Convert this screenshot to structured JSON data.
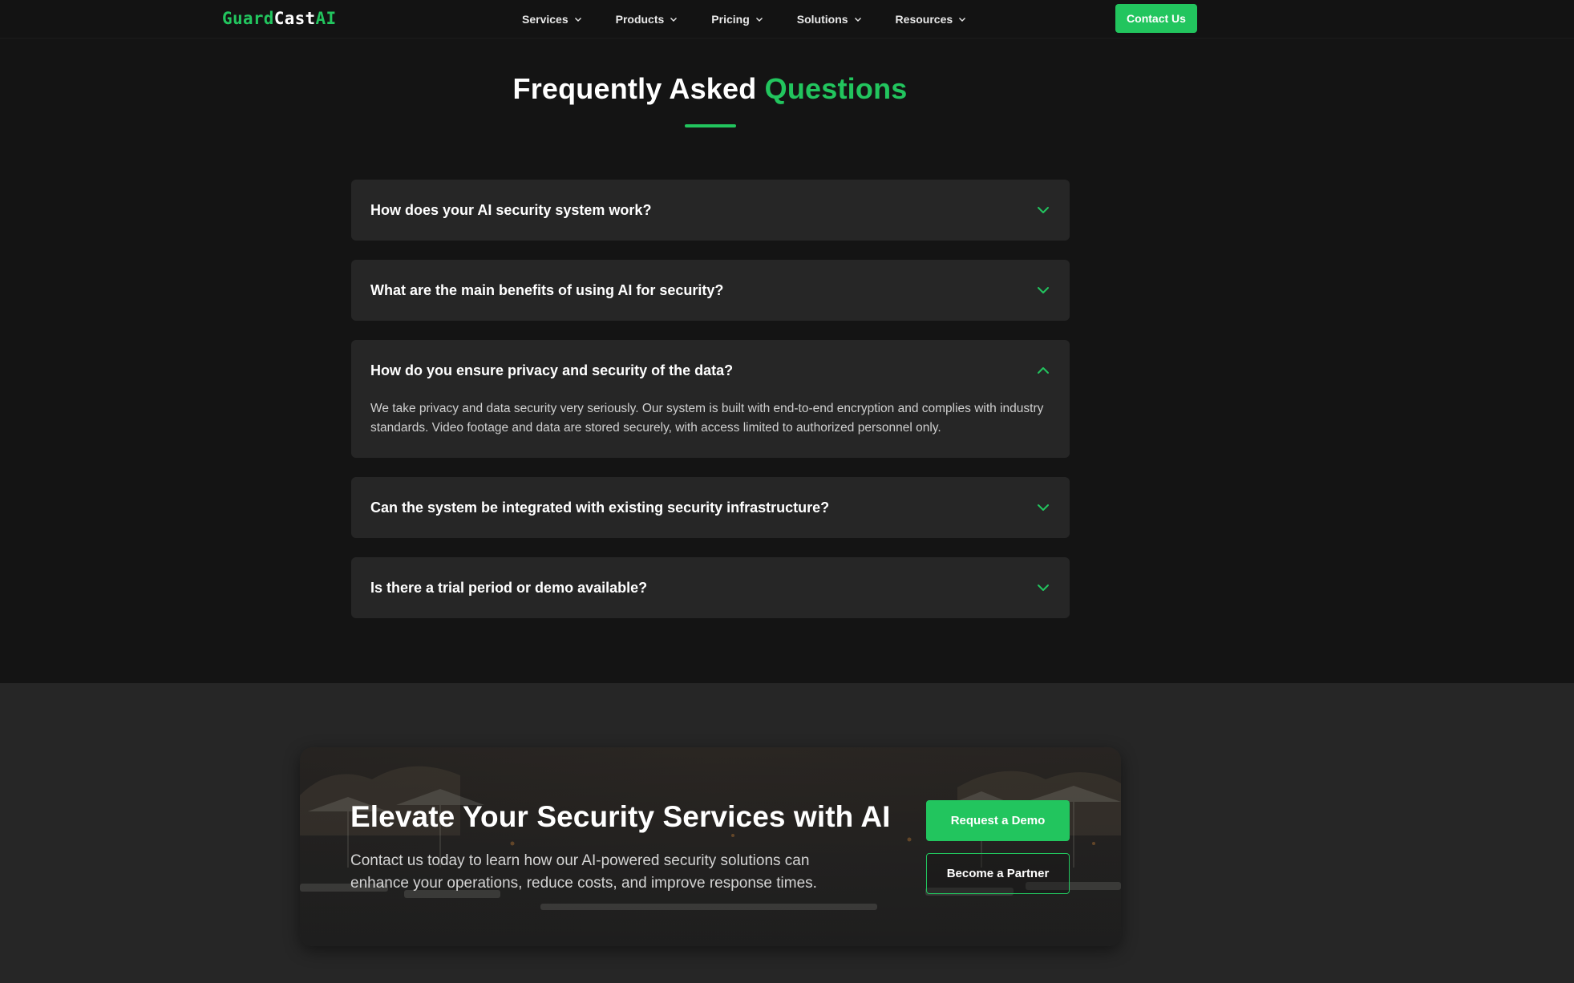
{
  "brand": {
    "logo_part1": "Guard",
    "logo_part2": "Cast",
    "logo_part3": "AI"
  },
  "nav": {
    "items": [
      {
        "label": "Services"
      },
      {
        "label": "Products"
      },
      {
        "label": "Pricing"
      },
      {
        "label": "Solutions"
      },
      {
        "label": "Resources"
      }
    ],
    "contact_label": "Contact Us"
  },
  "faq": {
    "title_part1": "Frequently Asked",
    "title_part2": "Questions",
    "items": [
      {
        "question": "How does your AI security system work?",
        "expanded": false
      },
      {
        "question": "What are the main benefits of using AI for security?",
        "expanded": false
      },
      {
        "question": "How do you ensure privacy and security of the data?",
        "expanded": true,
        "answer": "We take privacy and data security very seriously. Our system is built with end-to-end encryption and complies with industry standards. Video footage and data are stored securely, with access limited to authorized personnel only."
      },
      {
        "question": "Can the system be integrated with existing security infrastructure?",
        "expanded": false
      },
      {
        "question": "Is there a trial period or demo available?",
        "expanded": false
      }
    ]
  },
  "cta": {
    "heading": "Elevate Your Security Services with AI",
    "text": "Contact us today to learn how our AI-powered security solutions can enhance your operations, reduce costs, and improve response times.",
    "demo_label": "Request a Demo",
    "partner_label": "Become a Partner"
  },
  "colors": {
    "accent": "#22c55e",
    "background": "#141414",
    "card": "#262626"
  },
  "icons": {
    "nav_dropdown": "chevron-down-icon",
    "faq_collapsed": "chevron-down-icon",
    "faq_expanded": "chevron-up-icon"
  }
}
